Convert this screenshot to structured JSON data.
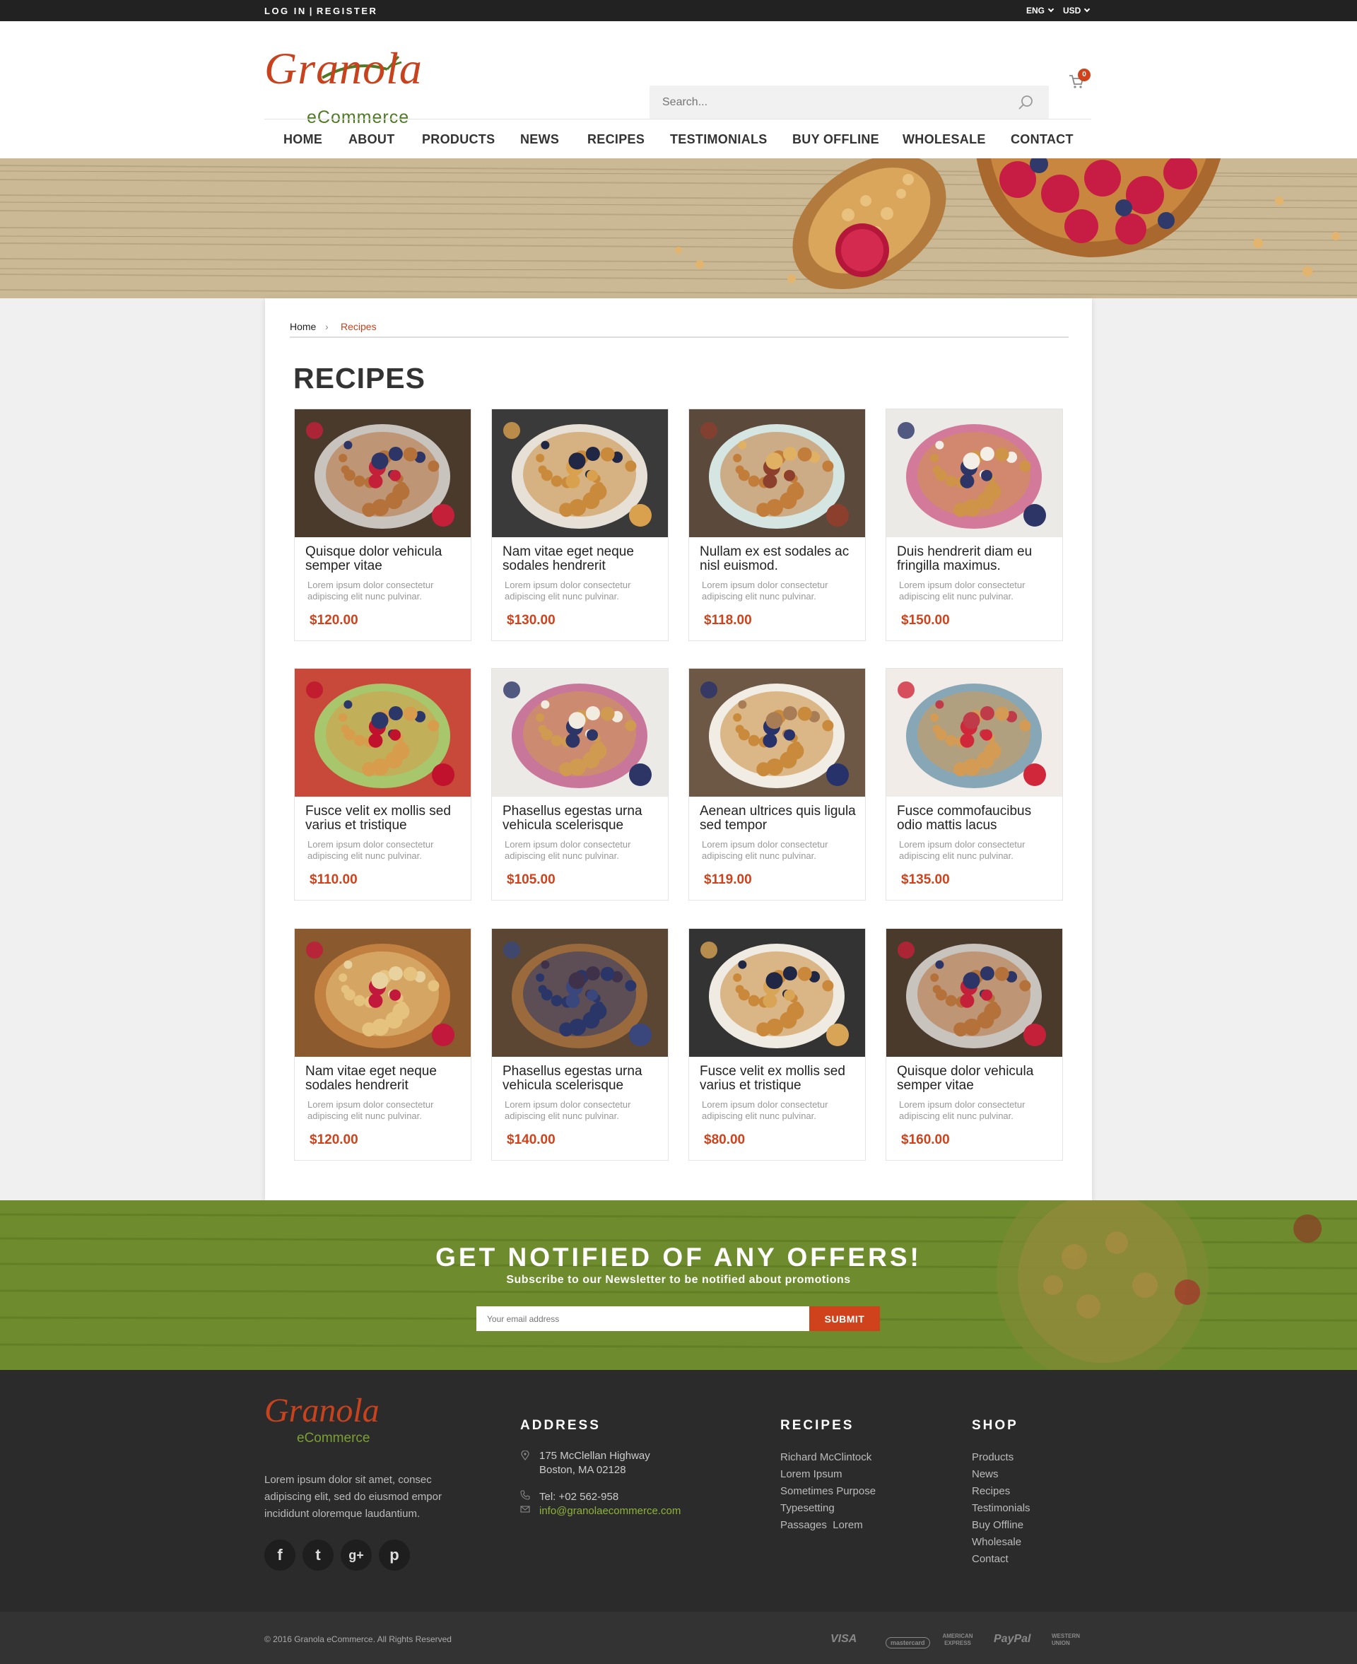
{
  "topbar": {
    "login": "LOG IN",
    "divider": "|",
    "register": "REGISTER",
    "language": "ENG",
    "currency": "USD"
  },
  "header": {
    "logo_word": "Granola",
    "logo_sub": "eCommerce",
    "search_placeholder": "Search...",
    "cart_count": "0"
  },
  "nav": [
    "HOME",
    "ABOUT",
    "PRODUCTS",
    "NEWS",
    "RECIPES",
    "TESTIMONIALS",
    "BUY OFFLINE",
    "WHOLESALE",
    "CONTACT"
  ],
  "breadcrumb": {
    "home": "Home",
    "separator": "›",
    "current": "Recipes"
  },
  "page_title": "RECIPES",
  "recipes": [
    {
      "name": "Quisque dolor vehicula semper vitae",
      "desc": "Lorem ipsum dolor consectetur adipiscing elit nunc pulvinar.",
      "price": "$120.00"
    },
    {
      "name": "Nam vitae eget neque sodales hendrerit",
      "desc": "Lorem ipsum dolor consectetur adipiscing elit nunc pulvinar.",
      "price": "$130.00"
    },
    {
      "name": "Nullam ex est sodales ac nisl euismod.",
      "desc": "Lorem ipsum dolor consectetur adipiscing elit nunc pulvinar.",
      "price": "$118.00"
    },
    {
      "name": "Duis hendrerit diam eu fringilla maximus.",
      "desc": "Lorem ipsum dolor consectetur adipiscing elit nunc pulvinar.",
      "price": "$150.00"
    },
    {
      "name": "Fusce velit ex mollis sed varius et tristique",
      "desc": "Lorem ipsum dolor consectetur adipiscing elit nunc pulvinar.",
      "price": "$110.00"
    },
    {
      "name": "Phasellus egestas urna vehicula scelerisque",
      "desc": "Lorem ipsum dolor consectetur adipiscing elit nunc pulvinar.",
      "price": "$105.00"
    },
    {
      "name": "Aenean ultrices quis ligula sed tempor",
      "desc": "Lorem ipsum dolor consectetur adipiscing elit nunc pulvinar.",
      "price": "$119.00"
    },
    {
      "name": "Fusce commofaucibus odio mattis lacus",
      "desc": "Lorem ipsum dolor consectetur adipiscing elit nunc pulvinar.",
      "price": "$135.00"
    },
    {
      "name": "Nam vitae eget neque sodales hendrerit",
      "desc": "Lorem ipsum dolor consectetur adipiscing elit nunc pulvinar.",
      "price": "$120.00"
    },
    {
      "name": "Phasellus egestas urna vehicula scelerisque",
      "desc": "Lorem ipsum dolor consectetur adipiscing elit nunc pulvinar.",
      "price": "$140.00"
    },
    {
      "name": "Fusce velit ex mollis sed varius et tristique",
      "desc": "Lorem ipsum dolor consectetur adipiscing elit nunc pulvinar.",
      "price": "$80.00"
    },
    {
      "name": "Quisque dolor vehicula semper vitae",
      "desc": "Lorem ipsum dolor consectetur adipiscing elit nunc pulvinar.",
      "price": "$160.00"
    }
  ],
  "newsletter": {
    "heading": "GET NOTIFIED OF ANY OFFERS!",
    "subheading": "Subscribe to our Newsletter to be notified about promotions",
    "placeholder": "Your email address",
    "button": "SUBMIT"
  },
  "footer": {
    "logo_word": "Granola",
    "logo_sub": "eCommerce",
    "about": "Lorem ipsum dolor sit amet, consec adipiscing elit, sed do eiusmod empor incididunt oloremque laudantium.",
    "address_heading": "ADDRESS",
    "address_line1": "175 McClellan Highway",
    "address_line2": "Boston, MA 02128",
    "phone": "Tel: +02 562-958",
    "email": "info@granolaecommerce.com",
    "recipes_heading": "RECIPES",
    "recipes_links": [
      "Richard McClintock",
      "Lorem Ipsum",
      "Sometimes Purpose",
      "Typesetting",
      "Passages  Lorem"
    ],
    "shop_heading": "SHOP",
    "shop_links": [
      "Products",
      "News",
      "Recipes",
      "Testimonials",
      "Buy Offline",
      "Wholesale",
      "Contact"
    ],
    "social": [
      "f",
      "t",
      "g+",
      "p"
    ]
  },
  "bottom": {
    "copyright": "© 2016 Granola eCommerce. All Rights Reserved",
    "payments": [
      "VISA",
      "mastercard",
      "AMERICAN EXPRESS",
      "PayPal",
      "WESTERN UNION"
    ]
  },
  "colors": {
    "accent": "#d0421b",
    "logo_red": "#c8431d",
    "logo_green": "#4f7a23",
    "newsletter_bg": "#6c8b2c",
    "footer_bg": "#2b2b2b"
  }
}
